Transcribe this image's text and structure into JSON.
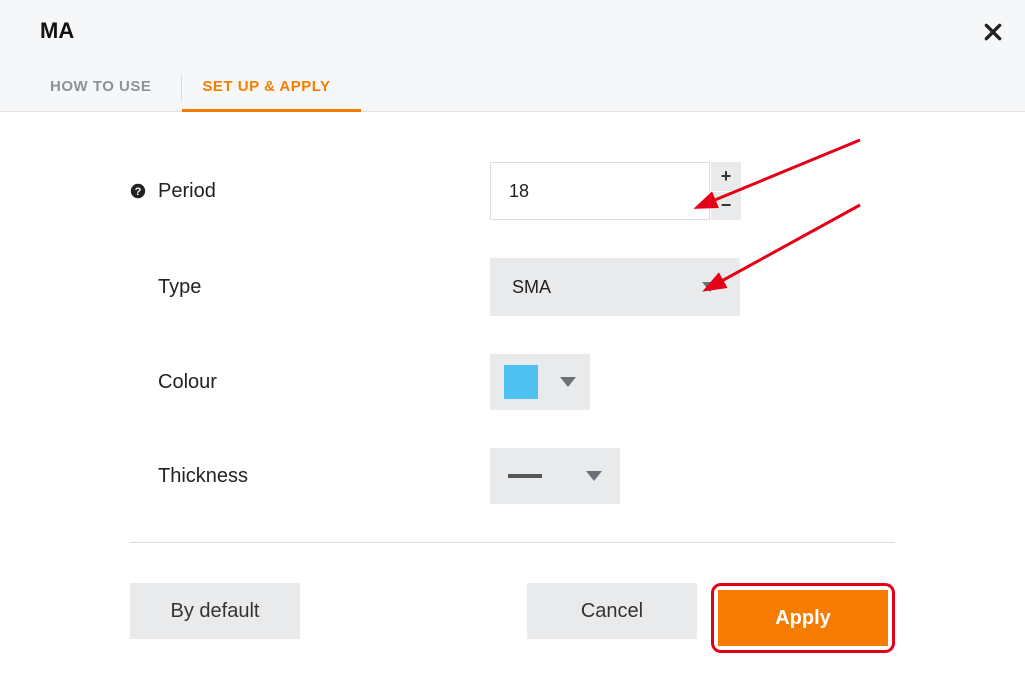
{
  "title": "MA",
  "tabs": {
    "how": "HOW TO USE",
    "setup": "SET UP & APPLY"
  },
  "labels": {
    "period": "Period",
    "type": "Type",
    "colour": "Colour",
    "thickness": "Thickness"
  },
  "values": {
    "period": "18",
    "type": "SMA",
    "colour": "#4ec0f2"
  },
  "buttons": {
    "default": "By default",
    "cancel": "Cancel",
    "apply": "Apply"
  }
}
